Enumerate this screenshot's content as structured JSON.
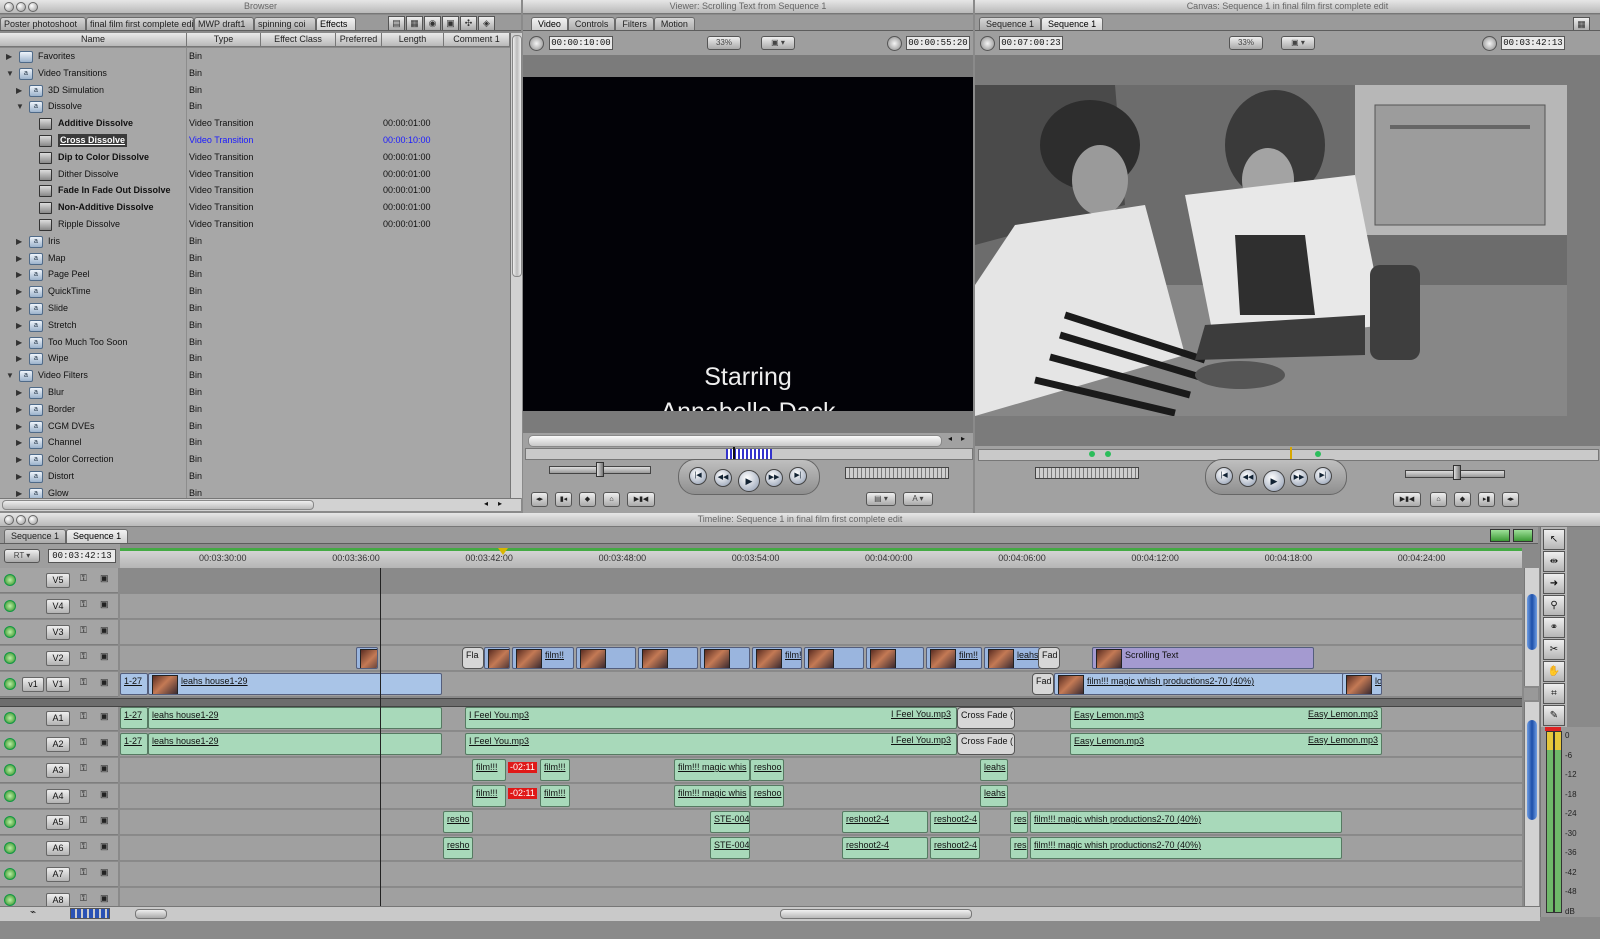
{
  "browser": {
    "title": "Browser",
    "tabs": [
      "Poster photoshoot",
      "final film first complete edit",
      "MWP draft1",
      "spinning coi",
      "Effects"
    ],
    "columns": [
      "Name",
      "Type",
      "Effect Class",
      "Preferred",
      "Length",
      "Comment 1"
    ],
    "rows": [
      {
        "name": "Favorites",
        "type": "Bin",
        "length": "",
        "indent": 0,
        "kind": "folder",
        "open": false,
        "bold": false,
        "selected": false
      },
      {
        "name": "Video Transitions",
        "type": "Bin",
        "length": "",
        "indent": 0,
        "kind": "bin",
        "open": true,
        "bold": false,
        "selected": false
      },
      {
        "name": "3D Simulation",
        "type": "Bin",
        "length": "",
        "indent": 1,
        "kind": "bin",
        "open": false,
        "bold": false,
        "selected": false
      },
      {
        "name": "Dissolve",
        "type": "Bin",
        "length": "",
        "indent": 1,
        "kind": "bin",
        "open": true,
        "bold": false,
        "selected": false
      },
      {
        "name": "Additive Dissolve",
        "type": "Video Transition",
        "length": "00:00:01:00",
        "indent": 2,
        "kind": "fx",
        "open": false,
        "bold": true,
        "selected": false
      },
      {
        "name": "Cross Dissolve",
        "type": "Video Transition",
        "length": "00:00:10:00",
        "indent": 2,
        "kind": "fx",
        "open": false,
        "bold": true,
        "selected": true
      },
      {
        "name": "Dip to Color Dissolve",
        "type": "Video Transition",
        "length": "00:00:01:00",
        "indent": 2,
        "kind": "fx",
        "open": false,
        "bold": true,
        "selected": false
      },
      {
        "name": "Dither Dissolve",
        "type": "Video Transition",
        "length": "00:00:01:00",
        "indent": 2,
        "kind": "fx",
        "open": false,
        "bold": false,
        "selected": false
      },
      {
        "name": "Fade In Fade Out Dissolve",
        "type": "Video Transition",
        "length": "00:00:01:00",
        "indent": 2,
        "kind": "fx",
        "open": false,
        "bold": true,
        "selected": false
      },
      {
        "name": "Non-Additive Dissolve",
        "type": "Video Transition",
        "length": "00:00:01:00",
        "indent": 2,
        "kind": "fx",
        "open": false,
        "bold": true,
        "selected": false
      },
      {
        "name": "Ripple Dissolve",
        "type": "Video Transition",
        "length": "00:00:01:00",
        "indent": 2,
        "kind": "fx",
        "open": false,
        "bold": false,
        "selected": false
      },
      {
        "name": "Iris",
        "type": "Bin",
        "length": "",
        "indent": 1,
        "kind": "bin",
        "open": false,
        "bold": false,
        "selected": false
      },
      {
        "name": "Map",
        "type": "Bin",
        "length": "",
        "indent": 1,
        "kind": "bin",
        "open": false,
        "bold": false,
        "selected": false
      },
      {
        "name": "Page Peel",
        "type": "Bin",
        "length": "",
        "indent": 1,
        "kind": "bin",
        "open": false,
        "bold": false,
        "selected": false
      },
      {
        "name": "QuickTime",
        "type": "Bin",
        "length": "",
        "indent": 1,
        "kind": "bin",
        "open": false,
        "bold": false,
        "selected": false
      },
      {
        "name": "Slide",
        "type": "Bin",
        "length": "",
        "indent": 1,
        "kind": "bin",
        "open": false,
        "bold": false,
        "selected": false
      },
      {
        "name": "Stretch",
        "type": "Bin",
        "length": "",
        "indent": 1,
        "kind": "bin",
        "open": false,
        "bold": false,
        "selected": false
      },
      {
        "name": "Too Much Too Soon",
        "type": "Bin",
        "length": "",
        "indent": 1,
        "kind": "bin",
        "open": false,
        "bold": false,
        "selected": false
      },
      {
        "name": "Wipe",
        "type": "Bin",
        "length": "",
        "indent": 1,
        "kind": "bin",
        "open": false,
        "bold": false,
        "selected": false
      },
      {
        "name": "Video Filters",
        "type": "Bin",
        "length": "",
        "indent": 0,
        "kind": "bin",
        "open": true,
        "bold": false,
        "selected": false
      },
      {
        "name": "Blur",
        "type": "Bin",
        "length": "",
        "indent": 1,
        "kind": "bin",
        "open": false,
        "bold": false,
        "selected": false
      },
      {
        "name": "Border",
        "type": "Bin",
        "length": "",
        "indent": 1,
        "kind": "bin",
        "open": false,
        "bold": false,
        "selected": false
      },
      {
        "name": "CGM DVEs",
        "type": "Bin",
        "length": "",
        "indent": 1,
        "kind": "bin",
        "open": false,
        "bold": false,
        "selected": false
      },
      {
        "name": "Channel",
        "type": "Bin",
        "length": "",
        "indent": 1,
        "kind": "bin",
        "open": false,
        "bold": false,
        "selected": false
      },
      {
        "name": "Color Correction",
        "type": "Bin",
        "length": "",
        "indent": 1,
        "kind": "bin",
        "open": false,
        "bold": false,
        "selected": false
      },
      {
        "name": "Distort",
        "type": "Bin",
        "length": "",
        "indent": 1,
        "kind": "bin",
        "open": false,
        "bold": false,
        "selected": false
      },
      {
        "name": "Glow",
        "type": "Bin",
        "length": "",
        "indent": 1,
        "kind": "bin",
        "open": false,
        "bold": false,
        "selected": false
      }
    ]
  },
  "viewer": {
    "title": "Viewer: Scrolling Text from Sequence 1",
    "tabs": [
      "Video",
      "Controls",
      "Filters",
      "Motion"
    ],
    "duration": "00:00:10:00",
    "zoom": "33%",
    "timecode": "00:00:55:20",
    "text_line1": "Starring",
    "text_line2": "Annabelle Dack"
  },
  "canvas": {
    "title": "Canvas: Sequence 1 in final film first complete edit",
    "tabs": [
      "Sequence 1",
      "Sequence 1"
    ],
    "duration": "00:07:00:23",
    "zoom": "33%",
    "timecode": "00:03:42:13"
  },
  "timeline": {
    "title": "Timeline: Sequence 1 in final film first complete edit",
    "tabs": [
      "Sequence 1",
      "Sequence 1"
    ],
    "rt": "RT",
    "timecode": "00:03:42:13",
    "ruler": [
      "00:03:30:00",
      "00:03:36:00",
      "00:03:42:00",
      "00:03:48:00",
      "00:03:54:00",
      "00:04:00:00",
      "00:04:06:00",
      "00:04:12:00",
      "00:04:18:00",
      "00:04:24:00"
    ],
    "src_patch": "v1",
    "tracks": [
      "V5",
      "V4",
      "V3",
      "V2",
      "V1",
      "A1",
      "A2",
      "A3",
      "A4",
      "A5",
      "A6",
      "A7",
      "A8"
    ],
    "clips": {
      "v2": [
        "Fla",
        "film!!",
        "film!!",
        "film!!",
        "leahs",
        "Fad",
        "Scrolling Text"
      ],
      "v1": [
        "1-27",
        "leahs house1-29",
        "Fad",
        "film!!! magic whish productions2-70 (40%)",
        "log"
      ],
      "a1": [
        "1-27",
        "leahs house1-29",
        "I Feel You.mp3",
        "I Feel You.mp3",
        "Cross Fade (",
        "Easy Lemon.mp3",
        "Easy Lemon.mp3"
      ],
      "a2": [
        "1-27",
        "leahs house1-29",
        "I Feel You.mp3",
        "I Feel You.mp3",
        "Cross Fade (",
        "Easy Lemon.mp3",
        "Easy Lemon.mp3"
      ],
      "a3": [
        "film!!!",
        "-02:11",
        "film!!!",
        "film!!! magic whis",
        "reshoo",
        "leahs"
      ],
      "a4": [
        "film!!!",
        "-02:11",
        "film!!!",
        "film!!! magic whis",
        "reshoo",
        "leahs"
      ],
      "a5": [
        "resho",
        "STE-004",
        "reshoot2-4",
        "reshoot2-4",
        "res",
        "film!!! magic whish productions2-70 (40%)"
      ],
      "a6": [
        "resho",
        "STE-004",
        "reshoot2-4",
        "reshoot2-4",
        "res",
        "film!!! magic whish productions2-70 (40%)"
      ]
    },
    "meter": [
      "0",
      "-6",
      "-12",
      "-18",
      "-24",
      "-30",
      "-36",
      "-42",
      "-48",
      "dB"
    ]
  },
  "colors": {
    "video_clip": "#a9c4e7",
    "audio_clip": "#a8d9ba",
    "scrolling_text_clip": "#a49ad0",
    "selection": "#1a1aff",
    "over_badge": "#e01818"
  }
}
